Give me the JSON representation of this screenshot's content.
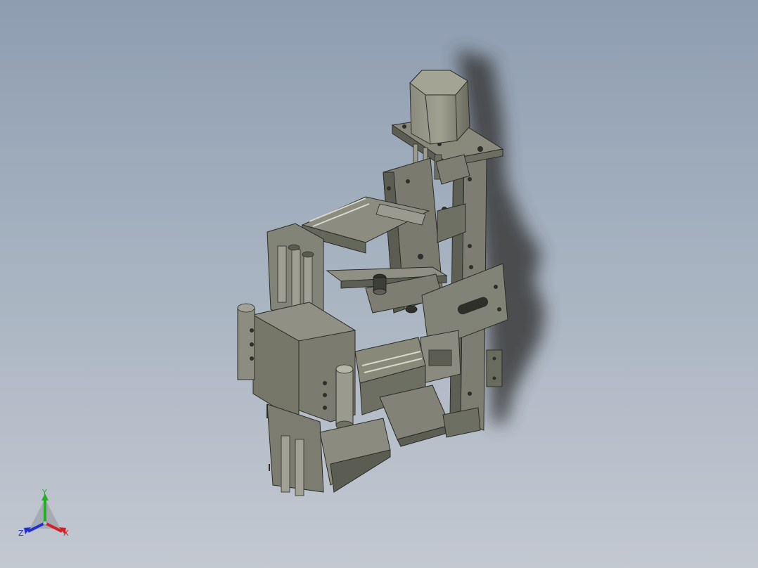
{
  "viewport": {
    "background_top": "#8e9db0",
    "background_bottom": "#c3c8d1",
    "model_color": "#77786a"
  },
  "triad": {
    "x_label": "X",
    "y_label": "Y",
    "z_label": "Z",
    "x_color": "#d42020",
    "y_color": "#20b020",
    "z_color": "#2030d0"
  }
}
